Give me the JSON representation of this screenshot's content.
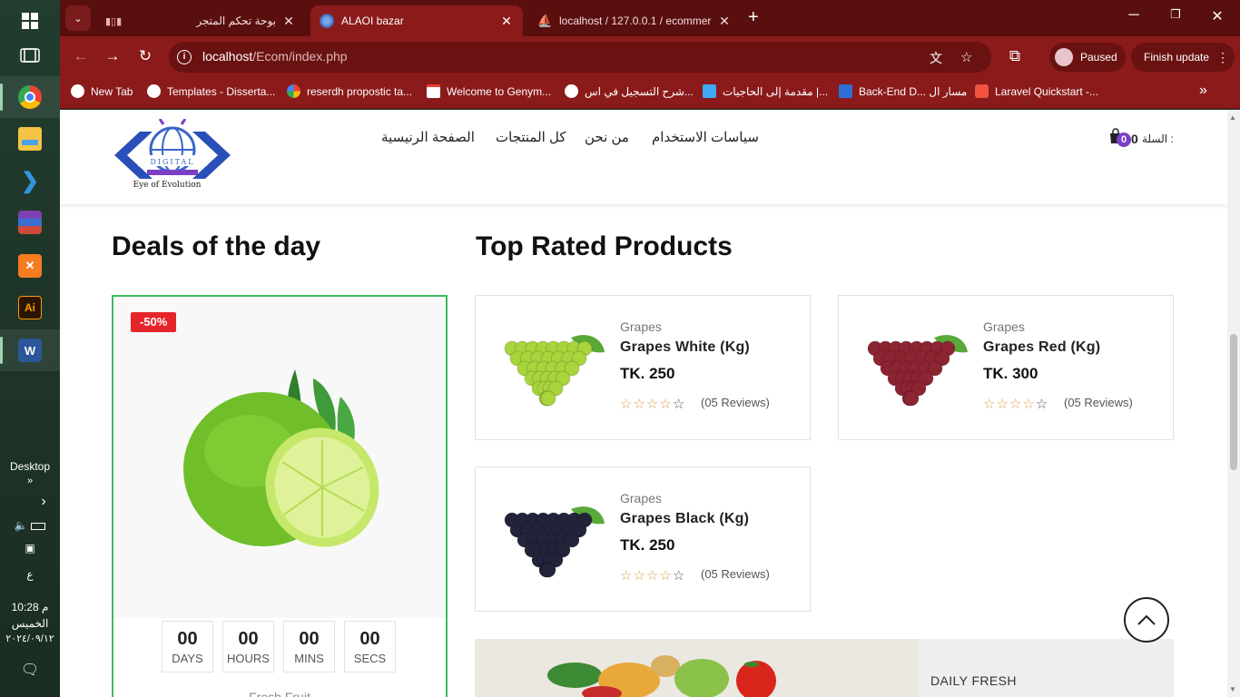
{
  "taskbar": {
    "desktop_label": "Desktop",
    "lang": "ع",
    "time": "10:28 م",
    "day": "الخميس",
    "date": "٢٠٢٤/٠٩/١٢",
    "icons": [
      "task-view-icon",
      "chrome-icon",
      "file-explorer-icon",
      "vscode-icon",
      "winrar-icon",
      "xampp-icon",
      "illustrator-icon",
      "word-icon"
    ]
  },
  "browser": {
    "tabs": [
      {
        "title": "بوحة تحكم المتجر",
        "active": false
      },
      {
        "title": "ALAOI bazar",
        "active": true
      },
      {
        "title": "localhost / 127.0.0.1 / ecommer",
        "active": false
      }
    ],
    "url_host": "localhost",
    "url_path": "/Ecom/index.php",
    "profile_label": "Paused",
    "finish_update_label": "Finish update",
    "bookmarks": [
      {
        "label": "New Tab",
        "color": "#ffffff"
      },
      {
        "label": "Templates - Disserta...",
        "color": "#ffffff"
      },
      {
        "label": "reserdh propostic ta...",
        "color": "#4285f4"
      },
      {
        "label": "Welcome to Genym...",
        "color": "#ea4335"
      },
      {
        "label": "شرح التسجيل في اس...",
        "color": "#ffffff"
      },
      {
        "label": "مقدمة إلى الحاجيات |...",
        "color": "#3fa9f5"
      },
      {
        "label": "Back-End D... مسار ال",
        "color": "#2f6fd6"
      },
      {
        "label": "Laravel Quickstart -...",
        "color": "#f05340"
      }
    ]
  },
  "site": {
    "logo": {
      "top": "ALA",
      "middle": "DIGITAL",
      "tagline": "Eye of Evolution"
    },
    "nav": [
      "الصفحة الرنيسية",
      "كل المنتجات",
      "من نحن",
      "سياسات الاستخدام"
    ],
    "cart": {
      "label": "السلة :",
      "count": "0",
      "badge": "0"
    }
  },
  "deals": {
    "title": "Deals of the day",
    "discount": "-50%",
    "countdown": [
      {
        "value": "00",
        "label": "DAYS"
      },
      {
        "value": "00",
        "label": "HOURS"
      },
      {
        "value": "00",
        "label": "MINS"
      },
      {
        "value": "00",
        "label": "SECS"
      }
    ],
    "caption": "Fresh Fruit"
  },
  "top_rated": {
    "title": "Top Rated Products",
    "products": [
      {
        "category": "Grapes",
        "name": "Grapes White (Kg)",
        "price": "TK. 250",
        "rating": 4,
        "reviews": "(05 Reviews)",
        "color": "#a8d43c"
      },
      {
        "category": "Grapes",
        "name": "Grapes Red (Kg)",
        "price": "TK. 300",
        "rating": 4,
        "reviews": "(05 Reviews)",
        "color": "#8c2432"
      },
      {
        "category": "Grapes",
        "name": "Grapes Black (Kg)",
        "price": "TK. 250",
        "rating": 4,
        "reviews": "(05 Reviews)",
        "color": "#23233a"
      }
    ]
  },
  "banner": {
    "text": "DAILY FRESH"
  }
}
